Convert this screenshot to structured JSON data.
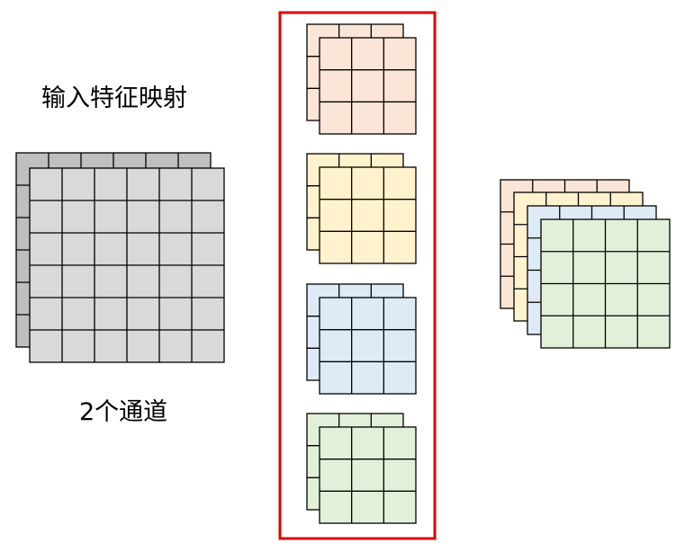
{
  "labels": {
    "input_title": "输入特征映射",
    "input_channels": "2个通道"
  },
  "colors": {
    "input_fill": "#d9d9d9",
    "kernel_fills": [
      "#fbe5d6",
      "#fff2cc",
      "#deebf7",
      "#e2f0d9"
    ],
    "grid_line": "#000000",
    "highlight_border": "#e00000"
  },
  "input_feature_map": {
    "channels": 2,
    "rows": 6,
    "cols": 6
  },
  "kernels": {
    "count": 4,
    "channels_each": 2,
    "rows": 3,
    "cols": 3
  },
  "output_feature_map": {
    "channels": 4,
    "rows": 4,
    "cols": 4
  }
}
